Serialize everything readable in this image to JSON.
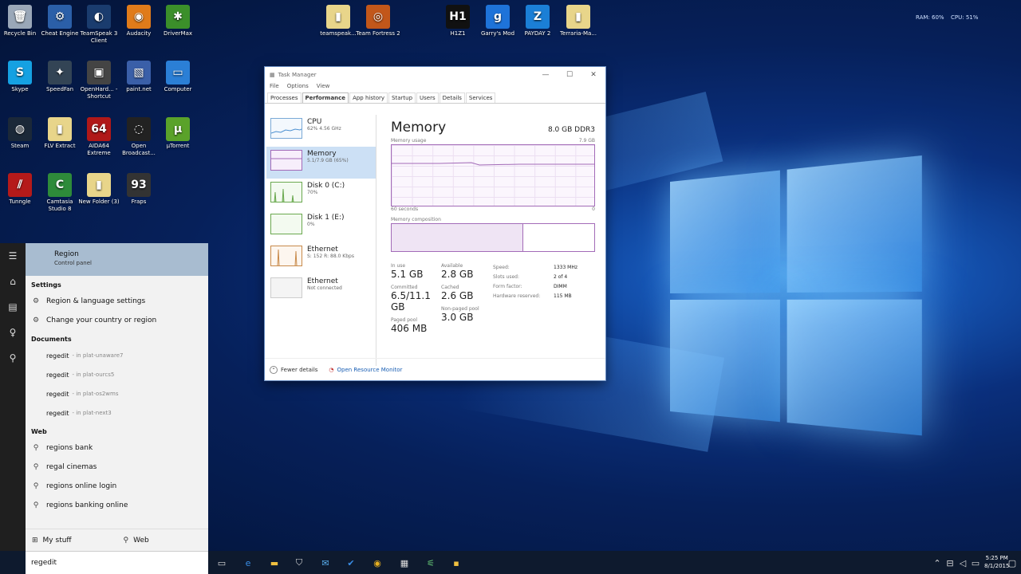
{
  "desktop": {
    "icons": [
      {
        "label": "Recycle Bin",
        "color": "#9aa7b8",
        "glyph": "🗑"
      },
      {
        "label": "Cheat Engine",
        "color": "#2b5fa8",
        "glyph": "⚙"
      },
      {
        "label": "TeamSpeak 3 Client",
        "color": "#1a3c6e",
        "glyph": "◐"
      },
      {
        "label": "Audacity",
        "color": "#e07b1a",
        "glyph": "◉"
      },
      {
        "label": "DriverMax",
        "color": "#3b8f2a",
        "glyph": "✱"
      },
      {
        "label": "teamspeak...",
        "color": "#e8d58a",
        "glyph": "▮"
      },
      {
        "label": "Team Fortress 2",
        "color": "#c2571a",
        "glyph": "◎"
      },
      {
        "label": "H1Z1",
        "color": "#111111",
        "glyph": "H1"
      },
      {
        "label": "Garry's Mod",
        "color": "#1e73d9",
        "glyph": "g"
      },
      {
        "label": "PAYDAY 2",
        "color": "#1b7fd6",
        "glyph": "Z"
      },
      {
        "label": "Terraria-Ma...",
        "color": "#e8d58a",
        "glyph": "▮"
      },
      {
        "label": "Skype",
        "color": "#15a1e2",
        "glyph": "S"
      },
      {
        "label": "SpeedFan",
        "color": "#334455",
        "glyph": "✦"
      },
      {
        "label": "OpenHard... - Shortcut",
        "color": "#444444",
        "glyph": "▣"
      },
      {
        "label": "paint.net",
        "color": "#3a5fa8",
        "glyph": "▧"
      },
      {
        "label": "Computer",
        "color": "#2b7fd6",
        "glyph": "▭"
      },
      {
        "label": "Steam",
        "color": "#1b2838",
        "glyph": "◍"
      },
      {
        "label": "FLV Extract",
        "color": "#e8d58a",
        "glyph": "▮"
      },
      {
        "label": "AIDA64 Extreme",
        "color": "#b01818",
        "glyph": "64"
      },
      {
        "label": "Open Broadcast...",
        "color": "#222222",
        "glyph": "◌"
      },
      {
        "label": "µTorrent",
        "color": "#5aa22a",
        "glyph": "µ"
      },
      {
        "label": "Tunngle",
        "color": "#b51a1a",
        "glyph": "⫽"
      },
      {
        "label": "Camtasia Studio 8",
        "color": "#2e8b3a",
        "glyph": "C"
      },
      {
        "label": "New Folder (3)",
        "color": "#e8d58a",
        "glyph": "▮"
      },
      {
        "label": "Fraps",
        "color": "#333333",
        "glyph": "93"
      }
    ],
    "tray_top": {
      "ram": "RAM: 60%",
      "cpu": "CPU: 51%"
    }
  },
  "task_manager": {
    "title": "Task Manager",
    "menu": [
      "File",
      "Options",
      "View"
    ],
    "tabs": [
      "Processes",
      "Performance",
      "App history",
      "Startup",
      "Users",
      "Details",
      "Services"
    ],
    "active_tab": "Performance",
    "sidebar": [
      {
        "name": "CPU",
        "sub": "62% 4.56 GHz"
      },
      {
        "name": "Memory",
        "sub": "5.1/7.9 GB (65%)"
      },
      {
        "name": "Disk 0 (C:)",
        "sub": "70%"
      },
      {
        "name": "Disk 1 (E:)",
        "sub": "0%"
      },
      {
        "name": "Ethernet",
        "sub": "S: 152 R: 88.0 Kbps"
      },
      {
        "name": "Ethernet",
        "sub": "Not connected"
      }
    ],
    "memory": {
      "title": "Memory",
      "type": "8.0 GB DDR3",
      "usage_label": "Memory usage",
      "usage_max": "7.9 GB",
      "time_label": "60 seconds",
      "time_zero": "0",
      "composition_label": "Memory composition",
      "in_use_label": "In use",
      "in_use": "5.1 GB",
      "available_label": "Available",
      "available": "2.8 GB",
      "committed_label": "Committed",
      "committed": "6.5/11.1 GB",
      "cached_label": "Cached",
      "cached": "2.6 GB",
      "paged_label": "Paged pool",
      "paged": "406 MB",
      "nonpaged_label": "Non-paged pool",
      "nonpaged": "3.0 GB",
      "speed_label": "Speed:",
      "speed": "1333 MHz",
      "slots_label": "Slots used:",
      "slots": "2 of 4",
      "form_label": "Form factor:",
      "form": "DIMM",
      "hw_label": "Hardware reserved:",
      "hw": "115 MB"
    },
    "footer": {
      "fewer": "Fewer details",
      "orm": "Open Resource Monitor"
    }
  },
  "search_panel": {
    "best_match": {
      "title": "Region",
      "sub": "Control panel"
    },
    "settings_header": "Settings",
    "settings": [
      "Region & language settings",
      "Change your country or region"
    ],
    "documents_header": "Documents",
    "documents": [
      {
        "name": "regedit",
        "hint": "- in plat-unaware7"
      },
      {
        "name": "regedit",
        "hint": "- in plat-ourcs5"
      },
      {
        "name": "regedit",
        "hint": "- in plat-os2wms"
      },
      {
        "name": "regedit",
        "hint": "- in plat-next3"
      }
    ],
    "web_header": "Web",
    "web": [
      "regions bank",
      "regal cinemas",
      "regions online login",
      "regions banking online"
    ],
    "bottom": {
      "mystuff": "My stuff",
      "web": "Web"
    },
    "query": "regedit"
  },
  "taskbar": {
    "time": "5:25 PM",
    "date": "8/1/2015"
  }
}
